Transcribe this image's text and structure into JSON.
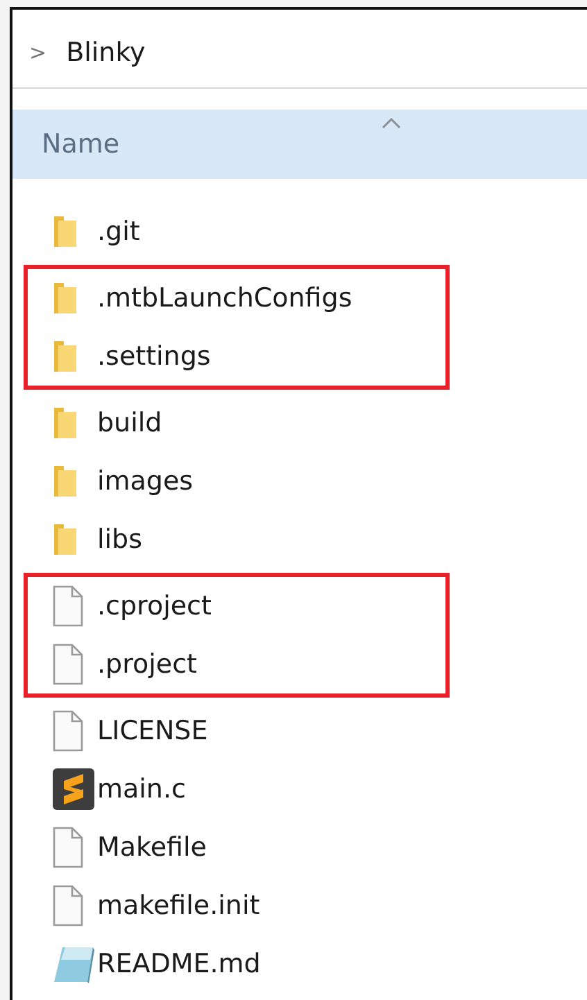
{
  "breadcrumb": {
    "separator": ">",
    "folder": "Blinky"
  },
  "column_header": {
    "label": "Name",
    "sorted_ascending": true
  },
  "groups": [
    {
      "highlighted": false,
      "items": [
        {
          "name": ".git",
          "kind": "folder"
        }
      ]
    },
    {
      "highlighted": true,
      "items": [
        {
          "name": ".mtbLaunchConfigs",
          "kind": "folder"
        },
        {
          "name": ".settings",
          "kind": "folder"
        }
      ]
    },
    {
      "highlighted": false,
      "items": [
        {
          "name": "build",
          "kind": "folder"
        },
        {
          "name": "images",
          "kind": "folder"
        },
        {
          "name": "libs",
          "kind": "folder"
        }
      ]
    },
    {
      "highlighted": true,
      "items": [
        {
          "name": ".cproject",
          "kind": "file"
        },
        {
          "name": ".project",
          "kind": "file"
        }
      ]
    },
    {
      "highlighted": false,
      "items": [
        {
          "name": "LICENSE",
          "kind": "file"
        },
        {
          "name": "main.c",
          "kind": "code"
        },
        {
          "name": "Makefile",
          "kind": "file"
        },
        {
          "name": "makefile.init",
          "kind": "file"
        },
        {
          "name": "README.md",
          "kind": "readme"
        }
      ]
    }
  ]
}
